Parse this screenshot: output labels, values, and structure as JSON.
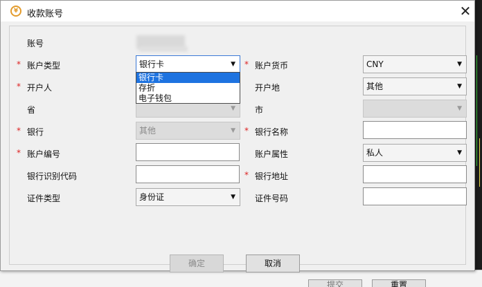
{
  "dialog": {
    "title": "收款账号",
    "icon": "coin-icon",
    "close_label": "✕"
  },
  "form": {
    "account_label": "账号",
    "account_type_label": "账户类型",
    "account_type_value": "银行卡",
    "account_type_options": [
      "银行卡",
      "存折",
      "电子钱包"
    ],
    "currency_label": "账户货币",
    "currency_value": "CNY",
    "holder_label": "开户人",
    "location_label": "开户地",
    "location_value": "其他",
    "province_label": "省",
    "city_label": "市",
    "bank_label": "银行",
    "bank_value": "其他",
    "bank_name_label": "银行名称",
    "account_no_label": "账户编号",
    "account_attr_label": "账户属性",
    "account_attr_value": "私人",
    "bank_code_label": "银行识别代码",
    "bank_address_label": "银行地址",
    "id_type_label": "证件类型",
    "id_type_value": "身份证",
    "id_no_label": "证件号码",
    "required_mark": "*"
  },
  "buttons": {
    "confirm": "确定",
    "cancel": "取消"
  },
  "background": {
    "submit": "提交",
    "reset": "重置"
  }
}
